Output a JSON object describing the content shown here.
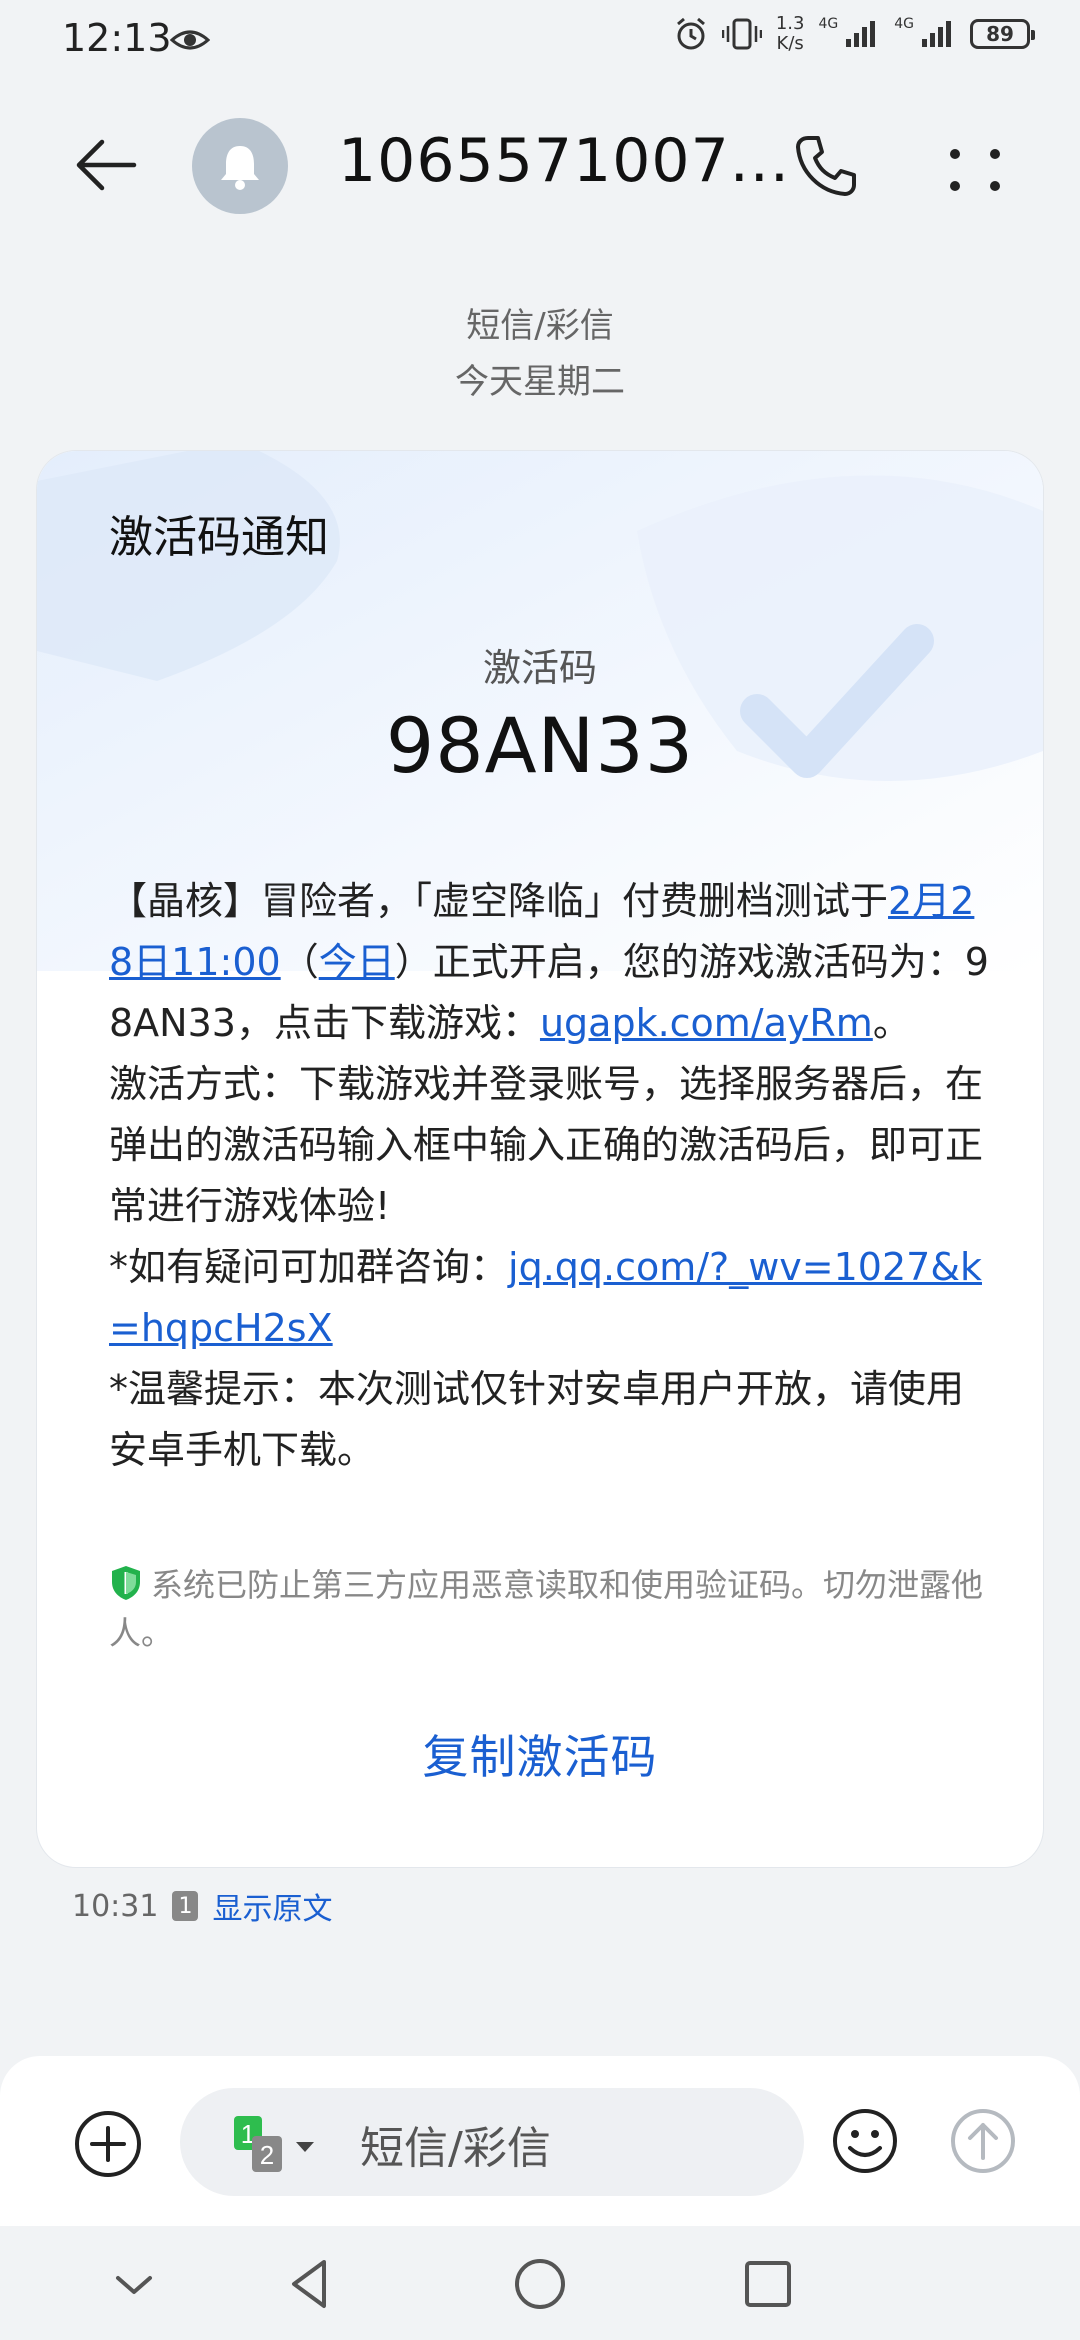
{
  "status_bar": {
    "time": "12:13",
    "speed_value": "1.3",
    "speed_unit": "K/s",
    "net1": "4G",
    "net2": "4G",
    "battery": "89"
  },
  "header": {
    "title": "1065571007..."
  },
  "thread_meta": {
    "type": "短信/彩信",
    "date": "今天星期二"
  },
  "message": {
    "card_title": "激活码通知",
    "code_label": "激活码",
    "code_value": "98AN33",
    "p1_a": "【晶核】冒险者，「虚空降临」付费删档测试于",
    "p1_link_date": "2月28日11:00",
    "p1_b": "（",
    "p1_link_today": "今日",
    "p1_c": "）正式开启，您的游戏激活码为：98AN33，点击下载游戏：",
    "p1_link_url": "ugapk.com/ayRm",
    "p1_d": "。",
    "p2": "激活方式：下载游戏并登录账号，选择服务器后，在弹出的激活码输入框中输入正确的激活码后，即可正常进行游戏体验!",
    "p3_a": "*如有疑问可加群咨询：",
    "p3_link": "jq.qq.com/?_wv=1027&k=hqpcH2sX",
    "p4": "*温馨提示：本次测试仅针对安卓用户开放，请使用安卓手机下载。",
    "security_note": "系统已防止第三方应用恶意读取和使用验证码。切勿泄露他人。",
    "copy_button": "复制激活码",
    "time": "10:31",
    "sim_slot": "1",
    "show_original": "显示原文"
  },
  "compose": {
    "sim1": "1",
    "sim2": "2",
    "placeholder": "短信/彩信"
  },
  "colors": {
    "link": "#1a5fd1",
    "shield": "#22b24c",
    "sim_green": "#2ebd4e"
  }
}
